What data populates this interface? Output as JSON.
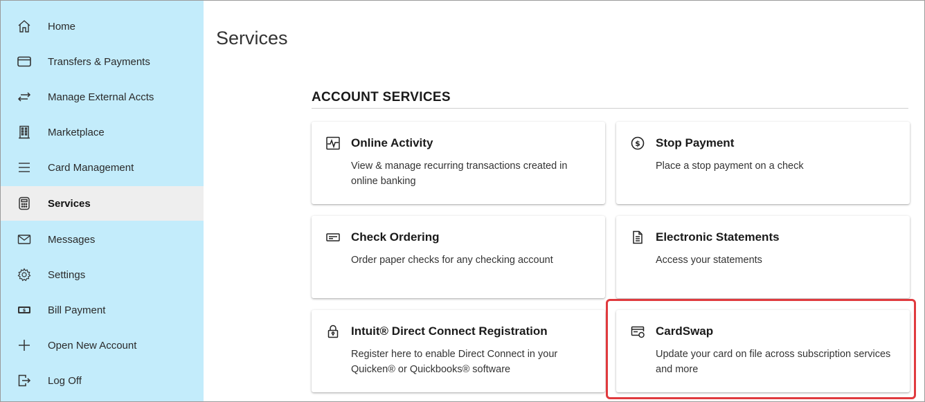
{
  "sidebar": {
    "items": [
      {
        "label": "Home",
        "icon": "home-icon",
        "active": false
      },
      {
        "label": "Transfers & Payments",
        "icon": "card-icon",
        "active": false
      },
      {
        "label": "Manage External Accts",
        "icon": "transfer-arrows-icon",
        "active": false
      },
      {
        "label": "Marketplace",
        "icon": "building-icon",
        "active": false
      },
      {
        "label": "Card Management",
        "icon": "menu-lines-icon",
        "active": false
      },
      {
        "label": "Services",
        "icon": "calculator-icon",
        "active": true
      },
      {
        "label": "Messages",
        "icon": "envelope-icon",
        "active": false
      },
      {
        "label": "Settings",
        "icon": "gear-icon",
        "active": false
      },
      {
        "label": "Bill Payment",
        "icon": "dollar-bill-icon",
        "active": false
      },
      {
        "label": "Open New Account",
        "icon": "plus-icon",
        "active": false
      },
      {
        "label": "Log Off",
        "icon": "logout-icon",
        "active": false
      }
    ]
  },
  "main": {
    "title": "Services",
    "section_heading": "ACCOUNT SERVICES",
    "cards": [
      {
        "title": "Online Activity",
        "icon": "activity-pulse-icon",
        "description": "View & manage recurring transactions created in online banking"
      },
      {
        "title": "Stop Payment",
        "icon": "dollar-circle-icon",
        "description": "Place a stop payment on a check"
      },
      {
        "title": "Check Ordering",
        "icon": "check-icon",
        "description": "Order paper checks for any checking account"
      },
      {
        "title": "Electronic Statements",
        "icon": "document-icon",
        "description": "Access your statements"
      },
      {
        "title": "Intuit® Direct Connect Registration",
        "icon": "lock-icon",
        "description": "Register here to enable Direct Connect in your Quicken® or Quickbooks® software"
      },
      {
        "title": "CardSwap",
        "icon": "card-swap-icon",
        "description": "Update your card on file across subscription services and more"
      }
    ]
  },
  "colors": {
    "sidebar_bg": "#c3ecfb",
    "active_item_bg": "#eeeeee",
    "highlight_border": "#e03a3e"
  }
}
